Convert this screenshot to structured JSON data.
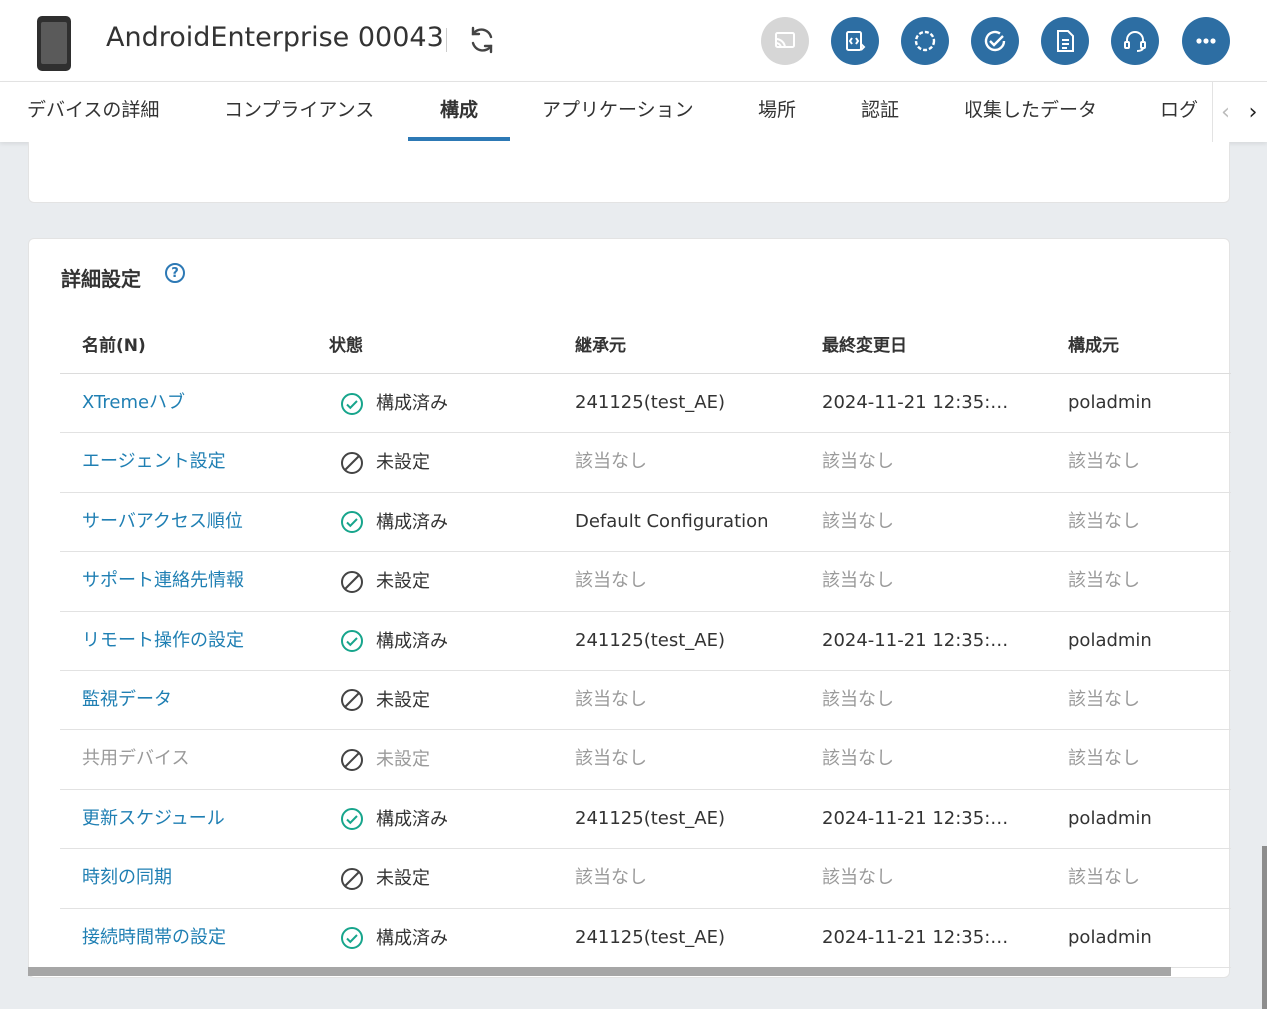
{
  "header": {
    "device_name": "AndroidEnterprise 00043",
    "device_icon": "phone-icon",
    "refresh_icon": "refresh-icon",
    "actions": [
      {
        "name": "cast-icon",
        "enabled": false
      },
      {
        "name": "remote-script-icon",
        "enabled": true
      },
      {
        "name": "sync-icon",
        "enabled": true
      },
      {
        "name": "check-icon",
        "enabled": true
      },
      {
        "name": "document-icon",
        "enabled": true
      },
      {
        "name": "support-icon",
        "enabled": true
      },
      {
        "name": "more-icon",
        "enabled": true
      }
    ],
    "accent_color": "#2d6ea3",
    "disabled_color": "#d6d6d6"
  },
  "tabs": [
    {
      "label": "デバイスの詳細",
      "active": false
    },
    {
      "label": "コンプライアンス",
      "active": false
    },
    {
      "label": "構成",
      "active": true
    },
    {
      "label": "アプリケーション",
      "active": false
    },
    {
      "label": "場所",
      "active": false
    },
    {
      "label": "認証",
      "active": false
    },
    {
      "label": "収集したデータ",
      "active": false
    },
    {
      "label": "ログ",
      "active": false
    }
  ],
  "section": {
    "title": "詳細設定",
    "help_label": "?"
  },
  "table": {
    "columns": [
      "名前(N)",
      "状態",
      "継承元",
      "最終変更日",
      "構成元"
    ],
    "rows": [
      {
        "name": "XTremeハブ",
        "status": "構成済み",
        "configured": true,
        "enabled": true,
        "inherited": "241125(test_AE)",
        "modified": "2024-11-21 12:35:…",
        "by": "poladmin"
      },
      {
        "name": "エージェント設定",
        "status": "未設定",
        "configured": false,
        "enabled": true,
        "inherited": "該当なし",
        "modified": "該当なし",
        "by": "該当なし"
      },
      {
        "name": "サーバアクセス順位",
        "status": "構成済み",
        "configured": true,
        "enabled": true,
        "inherited": "Default Configuration",
        "modified": "該当なし",
        "by": "該当なし"
      },
      {
        "name": "サポート連絡先情報",
        "status": "未設定",
        "configured": false,
        "enabled": true,
        "inherited": "該当なし",
        "modified": "該当なし",
        "by": "該当なし"
      },
      {
        "name": "リモート操作の設定",
        "status": "構成済み",
        "configured": true,
        "enabled": true,
        "inherited": "241125(test_AE)",
        "modified": "2024-11-21 12:35:…",
        "by": "poladmin"
      },
      {
        "name": "監視データ",
        "status": "未設定",
        "configured": false,
        "enabled": true,
        "inherited": "該当なし",
        "modified": "該当なし",
        "by": "該当なし"
      },
      {
        "name": "共用デバイス",
        "status": "未設定",
        "configured": false,
        "enabled": false,
        "inherited": "該当なし",
        "modified": "該当なし",
        "by": "該当なし"
      },
      {
        "name": "更新スケジュール",
        "status": "構成済み",
        "configured": true,
        "enabled": true,
        "inherited": "241125(test_AE)",
        "modified": "2024-11-21 12:35:…",
        "by": "poladmin"
      },
      {
        "name": "時刻の同期",
        "status": "未設定",
        "configured": false,
        "enabled": true,
        "inherited": "該当なし",
        "modified": "該当なし",
        "by": "該当なし"
      },
      {
        "name": "接続時間帯の設定",
        "status": "構成済み",
        "configured": true,
        "enabled": true,
        "inherited": "241125(test_AE)",
        "modified": "2024-11-21 12:35:…",
        "by": "poladmin"
      }
    ],
    "not_applicable_label": "該当なし",
    "link_color": "#1f7fb3",
    "configured_color": "#17a58c"
  }
}
